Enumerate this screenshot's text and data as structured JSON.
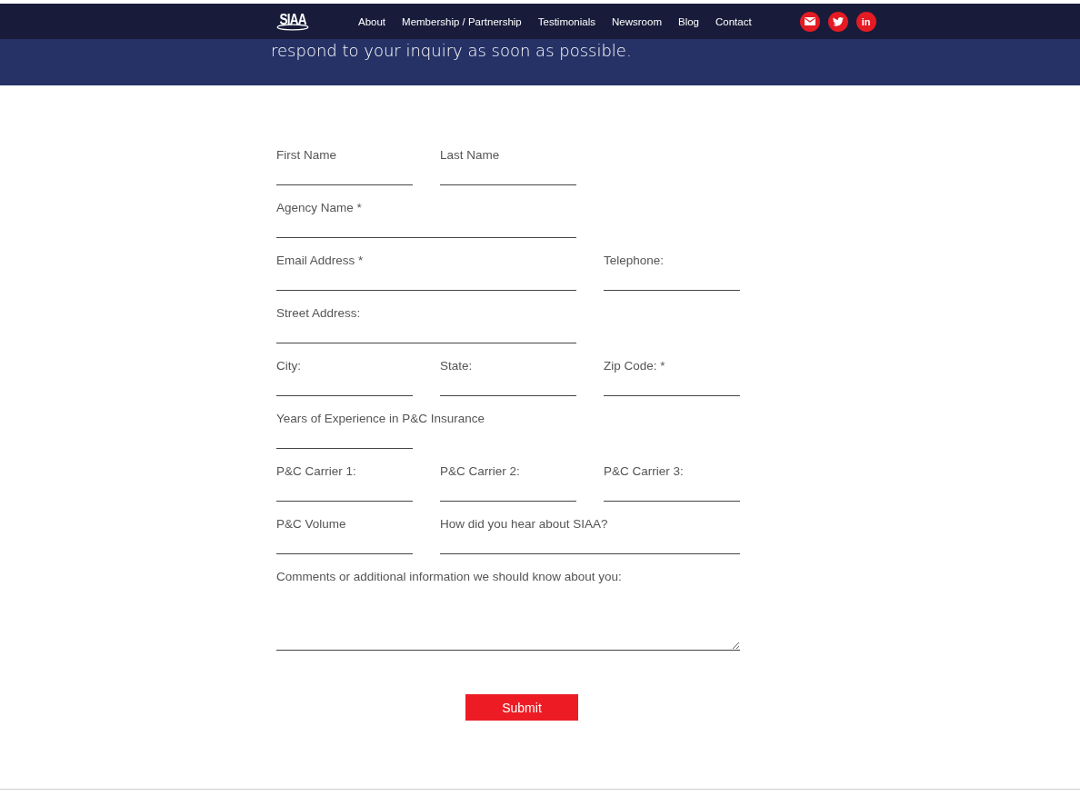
{
  "nav": {
    "logo": "SIAA",
    "links": [
      {
        "label": "About"
      },
      {
        "label": "Membership / Partnership"
      },
      {
        "label": "Testimonials"
      },
      {
        "label": "Newsroom"
      },
      {
        "label": "Blog"
      },
      {
        "label": "Contact"
      }
    ],
    "social": [
      {
        "kind": "mail"
      },
      {
        "kind": "twitter"
      },
      {
        "kind": "linkedin",
        "text": "in"
      }
    ]
  },
  "banner": {
    "text": "respond to your inquiry as soon as possible."
  },
  "form": {
    "rows": [
      {
        "fields": [
          {
            "kind": "single",
            "label": "First Name"
          },
          {
            "kind": "single",
            "label": "Last Name"
          }
        ]
      },
      {
        "fields": [
          {
            "kind": "double",
            "label": "Agency Name *"
          }
        ]
      },
      {
        "fields": [
          {
            "kind": "double",
            "label": "Email Address *"
          },
          {
            "kind": "single",
            "label": "Telephone:"
          }
        ]
      },
      {
        "fields": [
          {
            "kind": "double",
            "label": "Street Address:"
          }
        ]
      },
      {
        "fields": [
          {
            "kind": "single",
            "label": "City:"
          },
          {
            "kind": "single",
            "label": "State:"
          },
          {
            "kind": "single",
            "label": "Zip Code: *"
          }
        ]
      },
      {
        "fields": [
          {
            "kind": "single",
            "label": "Years of Experience in P&C Insurance"
          }
        ]
      },
      {
        "fields": [
          {
            "kind": "single",
            "label": "P&C Carrier 1:"
          },
          {
            "kind": "single",
            "label": "P&C Carrier 2:"
          },
          {
            "kind": "single",
            "label": "P&C Carrier 3:"
          }
        ]
      },
      {
        "fields": [
          {
            "kind": "single",
            "label": "P&C Volume"
          },
          {
            "kind": "double",
            "label": "How did you hear about SIAA?"
          }
        ]
      },
      {
        "fields": [
          {
            "kind": "textarea",
            "label": "Comments or additional information we should know about you:"
          }
        ]
      }
    ],
    "submit": "Submit"
  }
}
